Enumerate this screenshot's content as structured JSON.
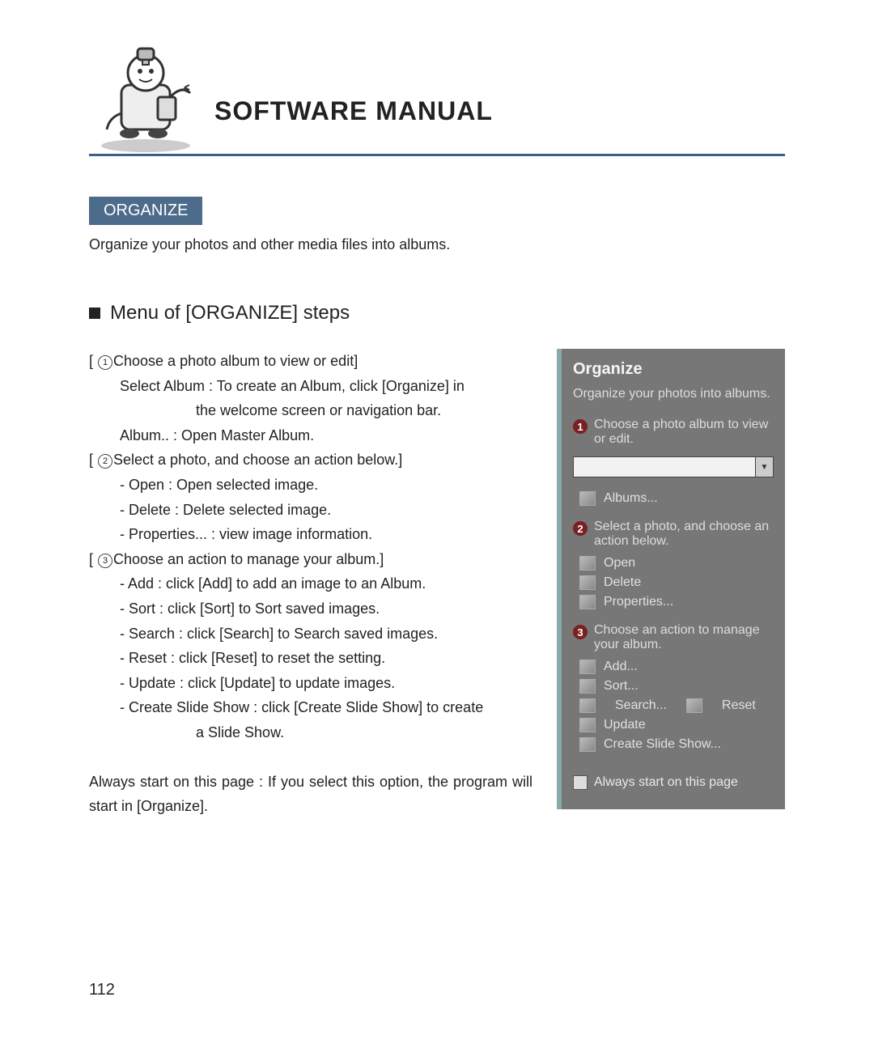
{
  "title": "SOFTWARE MANUAL",
  "section_label": "ORGANIZE",
  "intro": "Organize your photos and other media files into albums.",
  "subhead": "Menu of [ORGANIZE] steps",
  "steps": {
    "s1": {
      "num": "1",
      "head": "Choose a photo album to view or edit]",
      "lines": [
        "Select Album : To create an Album, click [Organize] in",
        "the welcome screen or navigation bar.",
        "Album.. : Open Master Album."
      ]
    },
    "s2": {
      "num": "2",
      "head": "Select a photo, and choose an action below.]",
      "lines": [
        "- Open : Open selected image.",
        "- Delete : Delete selected image.",
        "- Properties... : view image information."
      ]
    },
    "s3": {
      "num": "3",
      "head": "Choose an action to manage your album.]",
      "lines": [
        "- Add : click [Add] to add an image to an Album.",
        "- Sort : click [Sort] to Sort saved images.",
        "- Search : click [Search] to Search saved images.",
        "- Reset : click [Reset] to reset the setting.",
        "- Update : click [Update] to update images.",
        "- Create Slide Show : click [Create Slide Show] to create",
        "a Slide Show."
      ]
    }
  },
  "footer_para": "Always start on this page : If you select this option, the program will start in [Organize].",
  "panel": {
    "title": "Organize",
    "subtitle": "Organize your photos into albums.",
    "step1": {
      "num": "1",
      "text": "Choose a photo album to view or edit.",
      "album_item": "Albums..."
    },
    "step2": {
      "num": "2",
      "text": "Select a photo, and choose an action below.",
      "items": [
        "Open",
        "Delete",
        "Properties..."
      ]
    },
    "step3": {
      "num": "3",
      "text": "Choose an action to manage your album.",
      "items_a": [
        "Add...",
        "Sort..."
      ],
      "row_search": "Search...",
      "row_reset": "Reset",
      "items_b": [
        "Update",
        "Create Slide Show..."
      ]
    },
    "checkbox": "Always start on this page"
  },
  "page_number": "112"
}
